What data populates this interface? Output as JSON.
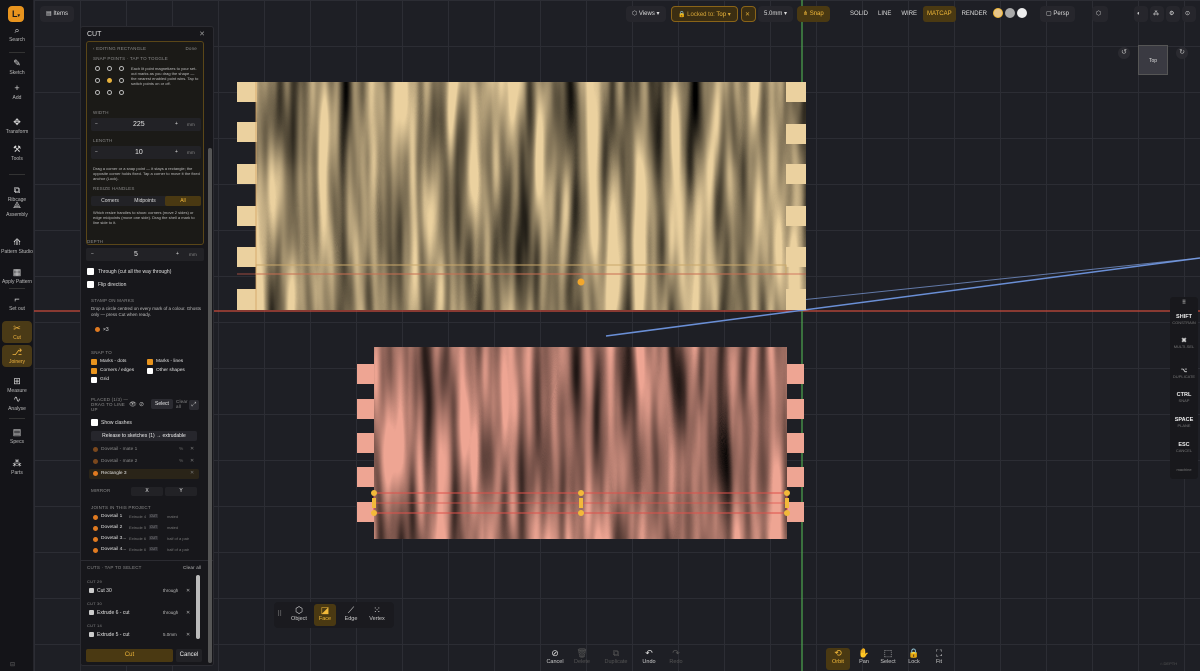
{
  "app": {
    "logo": "L",
    "items_label": "Items"
  },
  "rail": [
    {
      "name": "search",
      "label": "Search",
      "icon": "⌕"
    },
    {
      "name": "sketch",
      "label": "Sketch",
      "icon": "✎"
    },
    {
      "name": "add",
      "label": "Add",
      "icon": "+"
    },
    {
      "name": "transform",
      "label": "Transform",
      "icon": "✥"
    },
    {
      "name": "tools",
      "label": "Tools",
      "icon": "⚒"
    },
    {
      "name": "ribcage",
      "label": "Ribcage",
      "icon": "⧉"
    },
    {
      "name": "assembly",
      "label": "Assembly",
      "icon": "⟁"
    },
    {
      "name": "pattern-studio",
      "label": "Pattern Studio",
      "icon": "⟰"
    },
    {
      "name": "apply-pattern",
      "label": "Apply Pattern",
      "icon": "▦"
    },
    {
      "name": "set-out",
      "label": "Set out",
      "icon": "⌐"
    },
    {
      "name": "cut",
      "label": "Cut",
      "icon": "✂"
    },
    {
      "name": "joinery",
      "label": "Joinery",
      "icon": "⎇"
    },
    {
      "name": "measure",
      "label": "Measure",
      "icon": "⊞"
    },
    {
      "name": "analyse",
      "label": "Analyse",
      "icon": "∿"
    },
    {
      "name": "specs",
      "label": "Specs",
      "icon": "▤"
    },
    {
      "name": "parts",
      "label": "Parts",
      "icon": "⁂"
    }
  ],
  "toolbar": {
    "views": "Views",
    "locked_prefix": "Locked to:",
    "locked_value": "Top",
    "grid": "5.0mm",
    "snap": "Snap",
    "modes": [
      "SOLID",
      "LINE",
      "WIRE",
      "MATCAP",
      "RENDER"
    ],
    "active_mode": "MATCAP",
    "persp": "Persp"
  },
  "viewcube": {
    "face": "Top"
  },
  "panel": {
    "title": "CUT",
    "editing": "EDITING RECTANGLE",
    "done": "Done",
    "snap_points": "SNAP POINTS · TAP TO TOGGLE",
    "snap_help": "Each lit point magnetizes to your set-out marks as you drag the shape — the nearest enabled point wins. Tap to switch points on or off.",
    "width_label": "WIDTH",
    "width": "225",
    "width_unit": "mm",
    "length_label": "LENGTH",
    "length": "10",
    "length_unit": "mm",
    "drag_help": "Drag a corner or a snap point — it stays a rectangle; the opposite corner holds fixed. Tap a corner to move it the fixed anchor (Lock).",
    "resize_label": "RESIZE HANDLES",
    "resize_opts": [
      "Corners",
      "Midpoints",
      "All"
    ],
    "resize_sel": "All",
    "resize_help": "Which resize handles to show: corners (move 2 sides) or edge midpoints (move one side). Drag the shell a mark to line side to it.",
    "depth_label": "DEPTH",
    "depth": "5",
    "depth_unit": "mm",
    "through_label": "Through (cut all the way through)",
    "flip_label": "Flip direction",
    "stamp_label": "STAMP ON MARKS",
    "stamp_help": "Drop a circle centred on every mark of a colour. Ghosts only — press Cut when ready.",
    "stamp_count": "×3",
    "snap_to_label": "SNAP TO",
    "snap_opts": [
      {
        "label": "Marks - dots",
        "on": true
      },
      {
        "label": "Marks - lines",
        "on": true
      },
      {
        "label": "Corners / edges",
        "on": true
      },
      {
        "label": "Other shapes",
        "on": false
      },
      {
        "label": "Grid",
        "on": false
      }
    ],
    "placed_label": "PLACED (1/3) — DRAG TO LINE UP",
    "placed_select": "Select",
    "placed_clear": "Clear all",
    "show_clashes": "Show clashes",
    "release": "Release to sketches (1) → extrudable",
    "placed_items": [
      "Dovetail - mate 1",
      "Dovetail - mate 2",
      "Rectangle 3"
    ],
    "placed_tags": [
      "%",
      "%",
      ""
    ],
    "mirror_label": "MIRROR",
    "mirror_x": "X",
    "mirror_y": "Y",
    "joints_label": "JOINTS IN THIS PROJECT",
    "joints": [
      {
        "name": "Dovetail 1",
        "ref": "Extrude 4",
        "badge": "CUT",
        "state": "mated"
      },
      {
        "name": "Dovetail 2",
        "ref": "Extrude 5",
        "badge": "CUT",
        "state": "mated"
      },
      {
        "name": "Dovetail 3...",
        "ref": "Extrude 6",
        "badge": "CUT",
        "state": "half of a pair"
      },
      {
        "name": "Dovetail 4...",
        "ref": "Extrude 6",
        "badge": "CUT",
        "state": "half of a pair"
      }
    ],
    "cuts_label": "CUTS · TAP TO SELECT",
    "cuts_clear": "Clear all",
    "cuts": [
      {
        "group": "CUT 29",
        "name": "Cut 30",
        "val": "through"
      },
      {
        "group": "CUT 30",
        "name": "Extrude 6 - cut",
        "val": "through"
      },
      {
        "group": "CUT 14",
        "name": "Extrude 5 - cut",
        "val": "5.0mm"
      }
    ],
    "cut_btn": "Cut",
    "cancel_btn": "Cancel"
  },
  "pick": [
    "Object",
    "Face",
    "Edge",
    "Vertex"
  ],
  "pick_sel": "Face",
  "bottom": [
    {
      "label": "Cancel",
      "icon": "⊘",
      "dis": false
    },
    {
      "label": "Delete",
      "icon": "🗑",
      "dis": true
    },
    {
      "label": "Duplicate",
      "icon": "⧉",
      "dis": true
    },
    {
      "label": "Undo",
      "icon": "↶",
      "dis": false
    },
    {
      "label": "Redo",
      "icon": "↷",
      "dis": true
    }
  ],
  "nav": [
    {
      "label": "Orbit",
      "icon": "⟲"
    },
    {
      "label": "Pan",
      "icon": "✋"
    },
    {
      "label": "Select",
      "icon": "⬚"
    },
    {
      "label": "Lock",
      "icon": "🔒"
    },
    {
      "label": "Fit",
      "icon": "⛶"
    }
  ],
  "nav_sel": "Orbit",
  "keys": [
    {
      "k": "SHIFT",
      "d": "CONSTRAIN"
    },
    {
      "k": "⌘",
      "d": "MULTI-SEL"
    },
    {
      "k": "⌥",
      "d": "DUPLICATE"
    },
    {
      "k": "CTRL",
      "d": "SNAP"
    },
    {
      "k": "SPACE",
      "d": "PLANE"
    },
    {
      "k": "ESC",
      "d": "CANCEL"
    }
  ],
  "keys_footer": "machine",
  "colors": {
    "accent": "#e8941e",
    "wood_top": "#e9cf9c",
    "wood_bottom": "#eea593",
    "axis_red": "#d24a3a",
    "axis_green": "#4ea84e",
    "axis_blue": "#6a8fd6"
  }
}
